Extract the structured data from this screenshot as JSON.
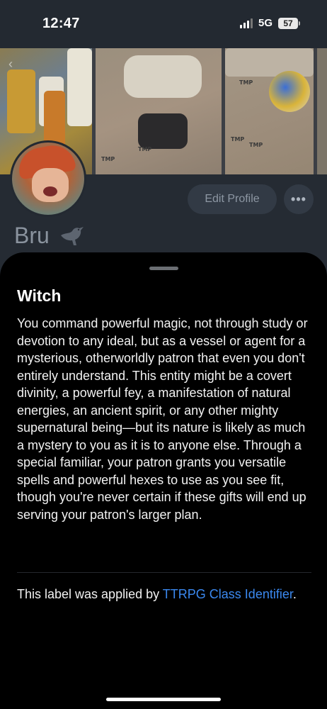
{
  "status_bar": {
    "time": "12:47",
    "network": "5G",
    "battery": "57"
  },
  "profile": {
    "name": "Bru",
    "edit_profile_label": "Edit Profile",
    "more_label": "•••"
  },
  "label_sheet": {
    "title": "Witch",
    "description": "You command powerful magic, not through study or devotion to any ideal, but as a vessel or agent for a mysterious, otherworldly patron that even you don't entirely understand. This entity might be a covert divinity, a powerful fey, a manifestation of natural energies, an ancient spirit, or any other mighty supernatural being—but its nature is likely as much a mystery to you as it is to anyone else. Through a special familiar, your patron grants you versatile spells and powerful hexes to use as you see fit, though you're never certain if these gifts will end up serving your patron's larger plan.",
    "attribution_prefix": "This label was applied by ",
    "labeler_name": "TTRPG Class Identifier",
    "attribution_suffix": "."
  },
  "banner": {
    "tmp_marks": [
      "TMP",
      "TMP",
      "TMP",
      "TMP",
      "TMP",
      "TMP"
    ]
  },
  "colors": {
    "sheet_background": "#000000",
    "link": "#3b89f0",
    "page_background": "#252b33"
  },
  "icons": {
    "back": "chevron-left-icon",
    "bird": "bird-icon",
    "more": "ellipsis-icon"
  }
}
